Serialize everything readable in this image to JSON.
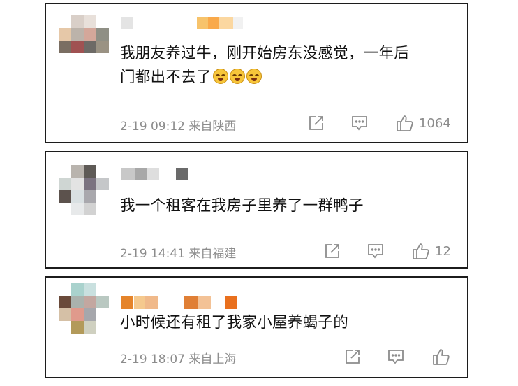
{
  "comments": [
    {
      "text_line1": "我朋友养过牛，刚开始房东没感觉，一年后",
      "text_line2": "门都出不去了",
      "timestamp": "2-19 09:12",
      "location": "来自陕西",
      "like_count": "1064",
      "emoji_count": 3,
      "avatar_colors": [
        "#ffffff",
        "#d9cfc8",
        "#e8e0da",
        "#ffffff",
        "#e6c8a8",
        "#bcb3aa",
        "#d4a79a",
        "#8f8f85",
        "#7a6e62",
        "#a05252",
        "#6d6a66",
        "#9a9283"
      ],
      "name_blocks": [
        {
          "color": "#e4e4e4"
        },
        {
          "color": "#f7c36b"
        },
        {
          "color": "#f9a94a"
        },
        {
          "color": "#fbd7a0"
        },
        {
          "color": "#f1f1f1"
        }
      ]
    },
    {
      "text_line1": "我一个租客在我房子里养了一群鸭子",
      "timestamp": "2-19 14:41",
      "location": "来自福建",
      "like_count": "12",
      "avatar_colors": [
        "#ffffff",
        "#b9b4ae",
        "#5e5a56",
        "#ffffff",
        "#cfd6d3",
        "#e3e3e3",
        "#7b7380",
        "#c5c7c9",
        "#5c524d",
        "#d9e0e2",
        "#a9a8ad",
        "#ffffff",
        "#ffffff",
        "#e7e9ea",
        "#d2d2d2",
        "#ffffff"
      ],
      "name_blocks": [
        {
          "color": "#c8c8c8"
        },
        {
          "color": "#a8a8a8"
        },
        {
          "color": "#dedede"
        },
        {
          "color": "#6a6a6a"
        }
      ]
    },
    {
      "text_line1": "小时候还有租了我家小屋养蝎子的",
      "timestamp": "2-19 18:07",
      "location": "来自上海",
      "like_count": "",
      "avatar_colors": [
        "#ffffff",
        "#a9d2cd",
        "#c9e0df",
        "#ffffff",
        "#6a4a3a",
        "#aab2ad",
        "#c3a7a0",
        "#b9c8c1",
        "#d5c0a6",
        "#e09a8c",
        "#a6a7ac",
        "#ffffff",
        "#ffffff",
        "#b39a5a",
        "#cfd0c0",
        "#ffffff"
      ],
      "name_blocks": [
        {
          "color": "#e5842a"
        },
        {
          "color": "#f5c98e"
        },
        {
          "color": "#f0b98a"
        },
        {
          "color": "#e07f35"
        },
        {
          "color": "#f3c296"
        },
        {
          "color": "#e9701e"
        }
      ]
    }
  ],
  "icons": {
    "share": "share-icon",
    "comment": "comment-icon",
    "like": "thumbs-up-icon"
  }
}
